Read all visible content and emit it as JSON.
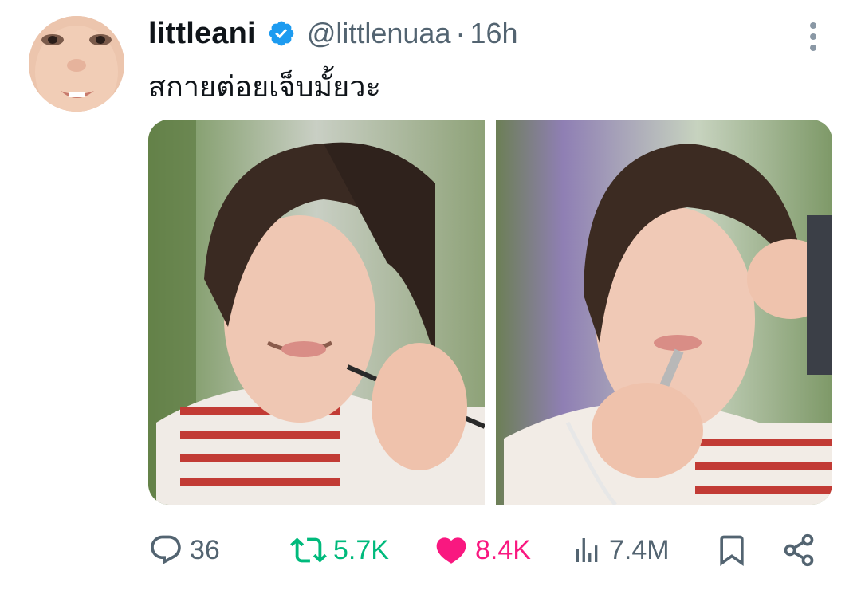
{
  "tweet": {
    "display_name": "littleani",
    "handle": "@littlenuaa",
    "separator": "·",
    "time": "16h",
    "text": "สกายต่อยเจ็บมั้ยวะ"
  },
  "icons": {
    "verified": "verified-badge-icon",
    "more": "more-vertical-icon",
    "reply": "reply-icon",
    "retweet": "retweet-icon",
    "like": "heart-icon",
    "views": "views-chart-icon",
    "bookmark": "bookmark-icon",
    "share": "share-icon"
  },
  "actions": {
    "replies": "36",
    "retweets": "5.7K",
    "likes": "8.4K",
    "views": "7.4M"
  },
  "colors": {
    "text_primary": "#0f1419",
    "text_secondary": "#536471",
    "verified_blue": "#1d9bf0",
    "retweet_green": "#00ba7c",
    "like_pink": "#f91880"
  }
}
